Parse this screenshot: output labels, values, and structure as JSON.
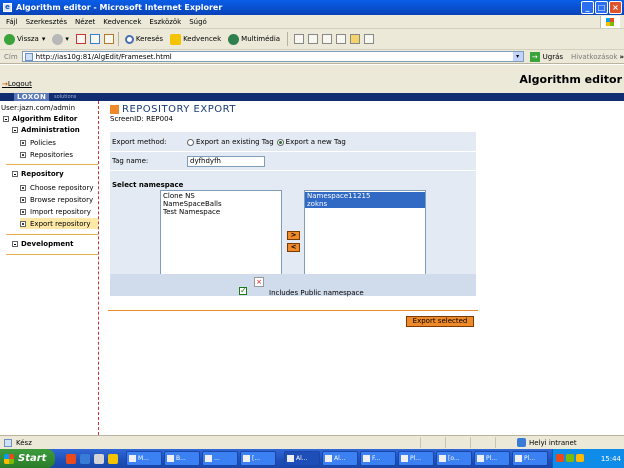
{
  "window": {
    "title": "Algorithm editor - Microsoft Internet Explorer"
  },
  "menubar": {
    "items": [
      "Fájl",
      "Szerkesztés",
      "Nézet",
      "Kedvencek",
      "Eszközök",
      "Súgó"
    ]
  },
  "toolbar": {
    "back_label": "Vissza",
    "search_label": "Keresés",
    "favorites_label": "Kedvencek",
    "media_label": "Multimédia"
  },
  "address": {
    "label": "Cím",
    "url": "http://ias10g:81/AlgEdit/Frameset.html",
    "go_label": "Ugrás",
    "links_label": "Hivatkozások"
  },
  "app": {
    "logout_label": "Logout",
    "title": "Algorithm editor",
    "logo_text": "LOXON",
    "logo_sub": "solutions"
  },
  "sidebar": {
    "user_label": "User:jazn.com/admin",
    "root_label": "Algorithm Editor",
    "sections": [
      {
        "label": "Administration",
        "items": [
          "Policies",
          "Repositories"
        ]
      },
      {
        "label": "Repository",
        "items": [
          "Choose repository",
          "Browse repository",
          "Import repository",
          "Export repository"
        ]
      },
      {
        "label": "Development",
        "items": []
      }
    ]
  },
  "main": {
    "title": "REPOSITORY EXPORT",
    "screen_id": "ScreenID: REP004",
    "export_method_label": "Export method:",
    "option_existing": "Export an existing Tag",
    "option_new": "Export a new Tag",
    "tag_name_label": "Tag name:",
    "tag_name_value": "dyfhdyfh",
    "select_namespace_label": "Select namespace",
    "available_namespaces": [
      "Clone NS",
      "NameSpaceBalls",
      "Test Namespace"
    ],
    "selected_namespaces": [
      "Namespace11215",
      "zokns"
    ],
    "move_right_label": ">",
    "move_left_label": "<",
    "include_public_label": "Includes Public namespace",
    "export_button_label": "Export selected"
  },
  "statusbar": {
    "status_text": "Kész",
    "zone_text": "Helyi intranet"
  },
  "taskbar": {
    "start_label": "Start",
    "tasks": [
      "M...",
      "B...",
      "...",
      "[...",
      "Al...",
      "Al...",
      "F...",
      "Pl...",
      "[o...",
      "Pl...",
      "Pl..."
    ],
    "tray_tasks": [
      "Ol..."
    ],
    "clock": "15:44"
  },
  "colors": {
    "accent_orange": "#ef8a2a",
    "brand_navy": "#0f2d70",
    "panel_blue": "#e4eaf4",
    "selection_blue": "#316ac5"
  }
}
